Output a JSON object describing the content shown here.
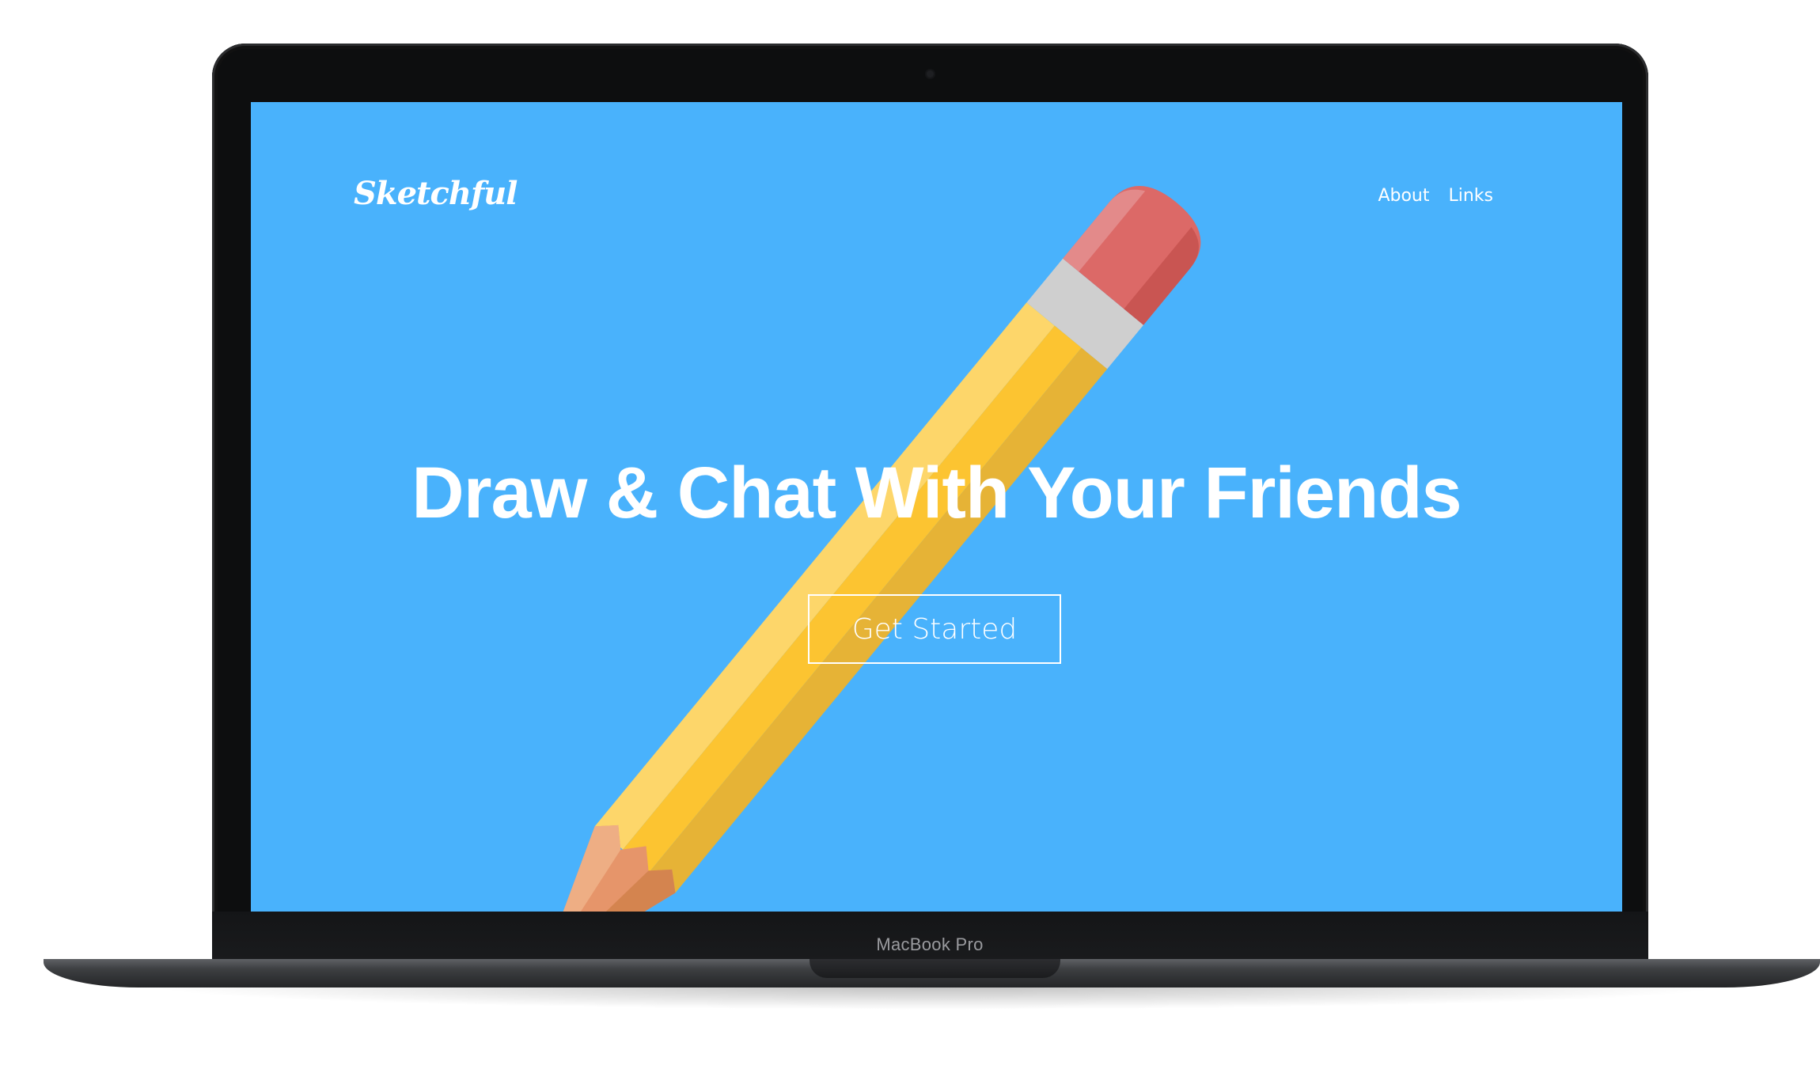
{
  "device": {
    "model_label": "MacBook Pro"
  },
  "site": {
    "logo": "Sketchful",
    "nav": [
      "About",
      "Links"
    ],
    "headline": "Draw & Chat With Your Friends",
    "cta_label": "Get Started"
  },
  "colors": {
    "screen_background": "#49b2fc",
    "pencil_body": "#fcc431",
    "pencil_eraser": "#dc6967",
    "pencil_ferrule": "#cfcfcf",
    "pencil_wood": "#e6956a",
    "pencil_lead": "#111111"
  },
  "icons": {
    "hero_art": "pencil-illustration"
  }
}
